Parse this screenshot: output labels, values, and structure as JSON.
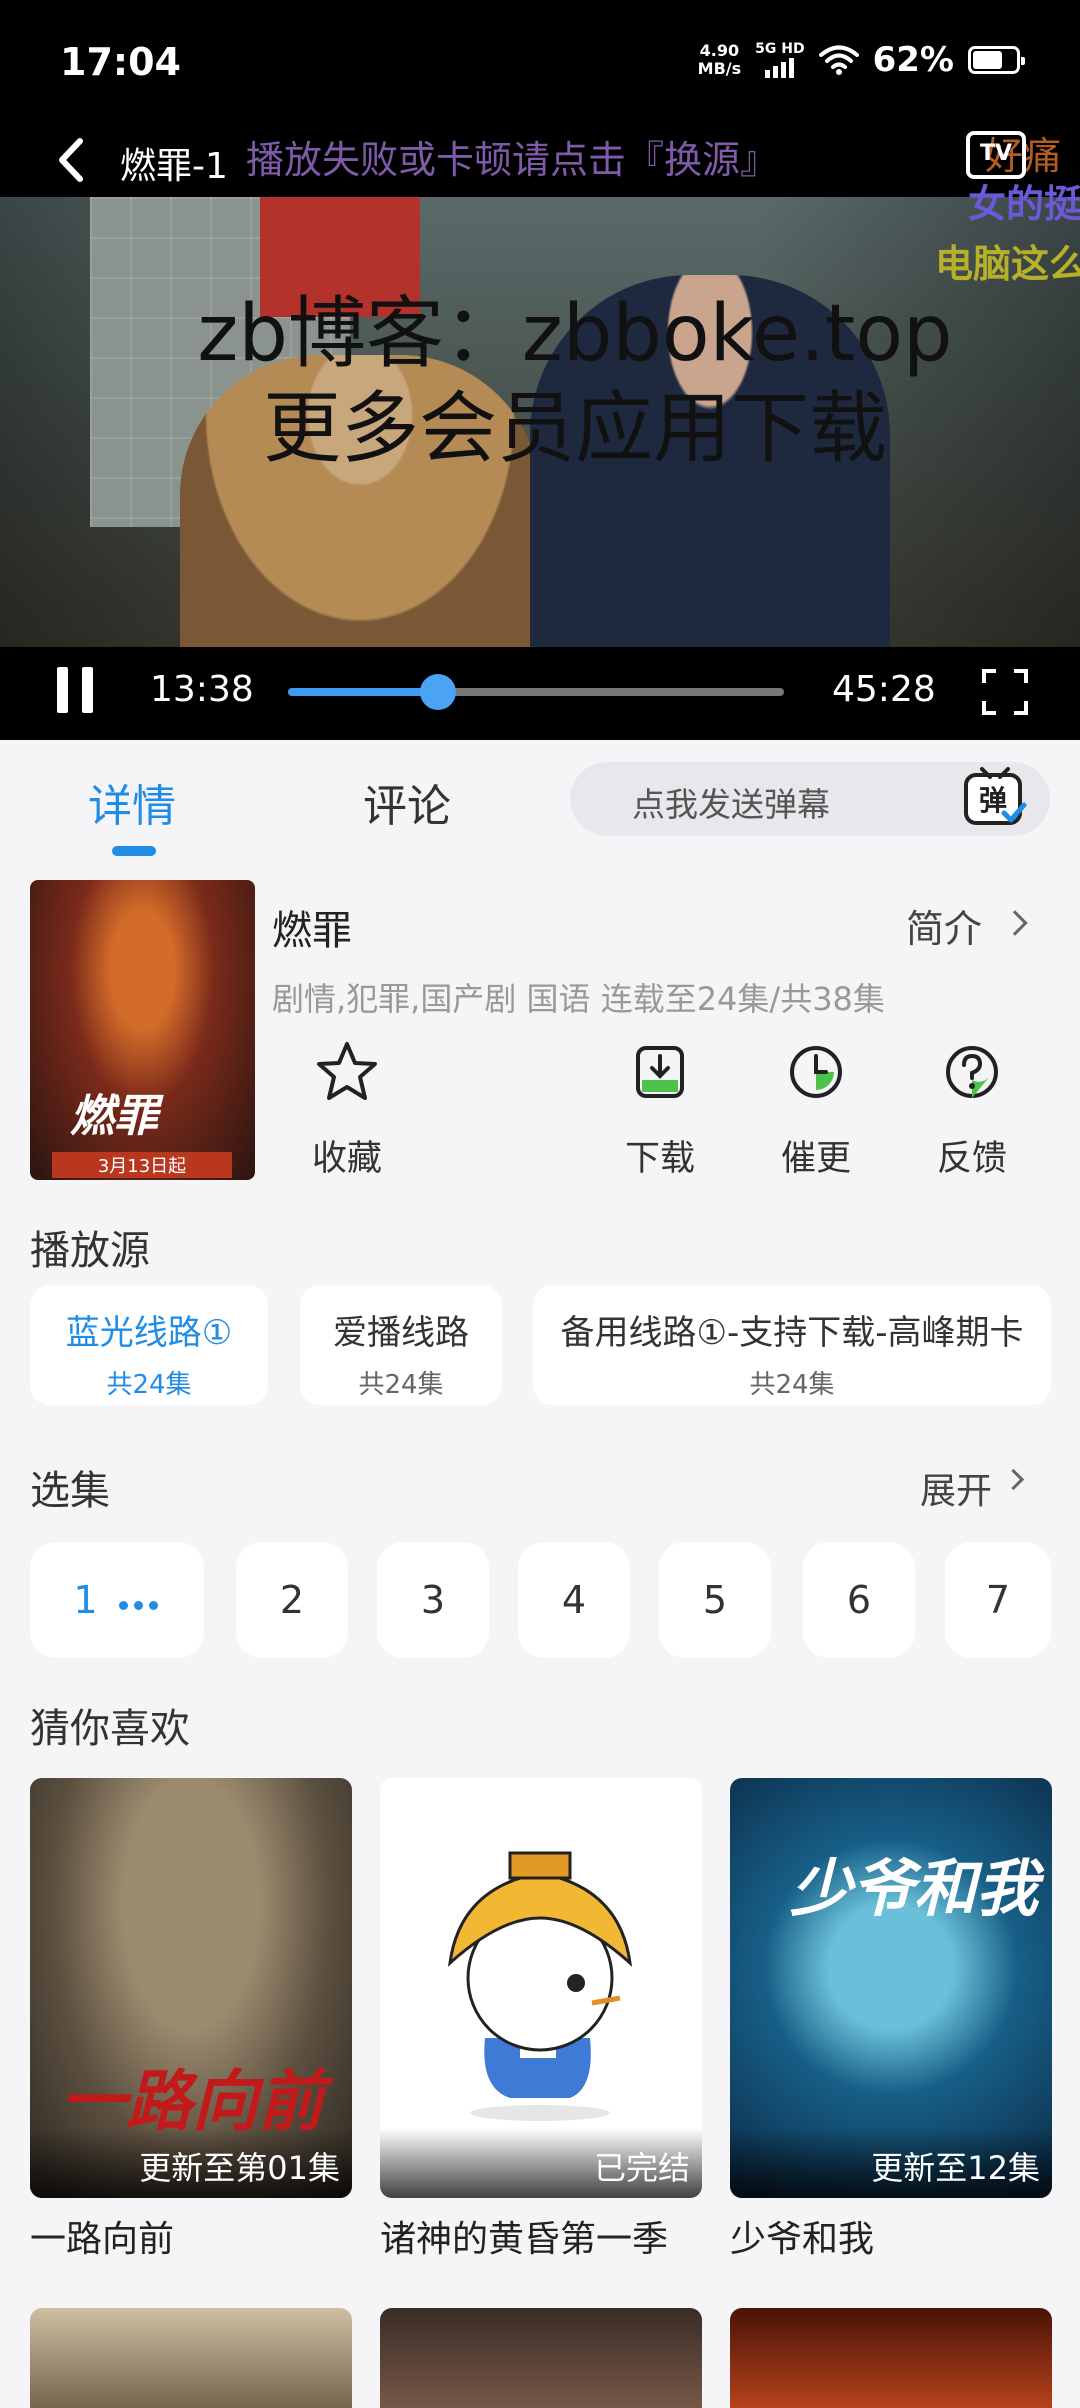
{
  "status_bar": {
    "time": "17:04",
    "net_speed_value": "4.90",
    "net_speed_unit": "MB/s",
    "network": "5G HD",
    "battery": "62%"
  },
  "player": {
    "title": "燃罪-1",
    "notice": "播放失败或卡顿请点击『换源』",
    "danmaku": [
      "好痛",
      "女的挺",
      "电脑这么"
    ],
    "tv_label": "TV",
    "watermark_line1": "zb博客：zbboke.top",
    "watermark_line2": "更多会员应用下载",
    "current_time": "13:38",
    "total_time": "45:28",
    "progress": 0.302
  },
  "tabs": {
    "detail": "详情",
    "comment": "评论",
    "danmu_placeholder": "点我发送弹幕",
    "danmu_icon_text": "弹"
  },
  "show": {
    "poster_title": "燃罪",
    "poster_sub": "3月13日起",
    "title": "燃罪",
    "intro_label": "简介",
    "meta": "剧情,犯罪,国产剧 国语 连载至24集/共38集"
  },
  "actions": {
    "favorite": "收藏",
    "download": "下载",
    "urge": "催更",
    "feedback": "反馈"
  },
  "sources": {
    "title": "播放源",
    "items": [
      {
        "name": "蓝光线路①",
        "count": "共24集"
      },
      {
        "name": "爱播线路",
        "count": "共24集"
      },
      {
        "name": "备用线路①-支持下载-高峰期卡",
        "count": "共24集"
      }
    ]
  },
  "episodes": {
    "title": "选集",
    "expand": "展开",
    "items": [
      "1",
      "2",
      "3",
      "4",
      "5",
      "6",
      "7"
    ]
  },
  "recommend": {
    "title": "猜你喜欢",
    "items": [
      {
        "name": "一路向前",
        "badge": "更新至第01集",
        "poster_text": "一路向前"
      },
      {
        "name": "诸神的黄昏第一季",
        "badge": "已完结"
      },
      {
        "name": "少爷和我",
        "badge": "更新至12集",
        "poster_text": "少爷和我"
      }
    ]
  },
  "colors": {
    "accent": "#1f8ce6",
    "player_bg": "#000000",
    "page_bg": "#f5f5f7"
  }
}
